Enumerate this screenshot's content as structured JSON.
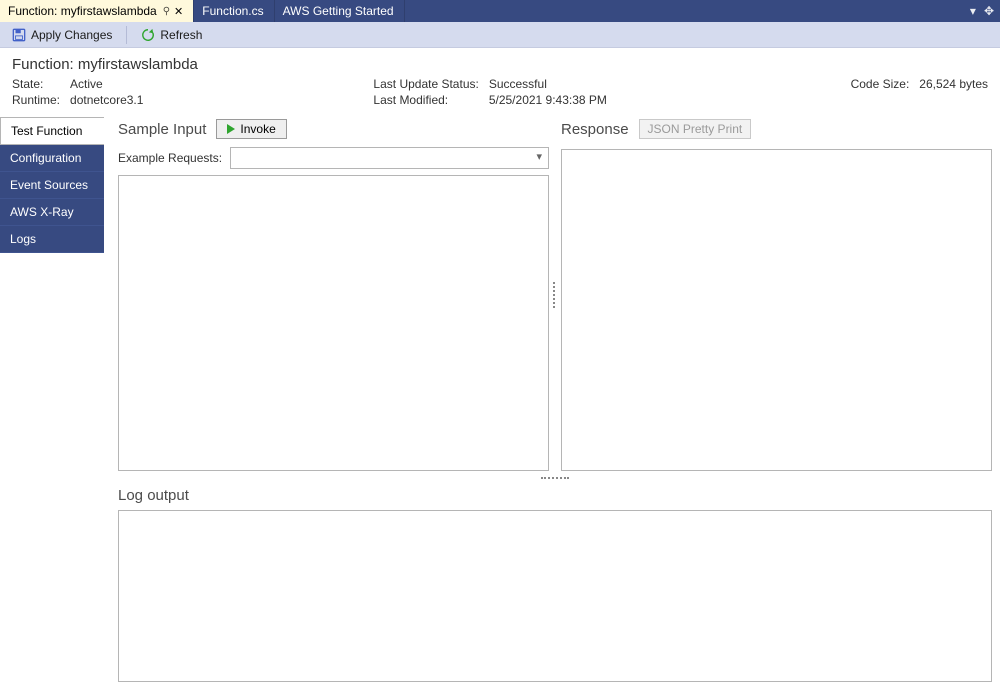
{
  "tabs": [
    {
      "label": "Function: myfirstawslambda",
      "active": true
    },
    {
      "label": "Function.cs",
      "active": false
    },
    {
      "label": "AWS Getting Started",
      "active": false
    }
  ],
  "toolbar": {
    "apply_changes": "Apply Changes",
    "refresh": "Refresh"
  },
  "header": {
    "title_prefix": "Function:",
    "function_name": "myfirstawslambda",
    "state_label": "State:",
    "state_value": "Active",
    "runtime_label": "Runtime:",
    "runtime_value": "dotnetcore3.1",
    "last_update_status_label": "Last Update Status:",
    "last_update_status_value": "Successful",
    "last_modified_label": "Last Modified:",
    "last_modified_value": "5/25/2021 9:43:38 PM",
    "code_size_label": "Code Size:",
    "code_size_value": "26,524 bytes"
  },
  "sidebar": {
    "items": [
      "Test Function",
      "Configuration",
      "Event Sources",
      "AWS X-Ray",
      "Logs"
    ],
    "active_index": 0
  },
  "test_panel": {
    "sample_input_title": "Sample Input",
    "invoke_label": "Invoke",
    "example_requests_label": "Example Requests:",
    "example_requests_value": "",
    "response_title": "Response",
    "pretty_print_label": "JSON Pretty Print",
    "log_output_title": "Log output",
    "sample_input_text": "",
    "response_text": "",
    "log_text": ""
  }
}
